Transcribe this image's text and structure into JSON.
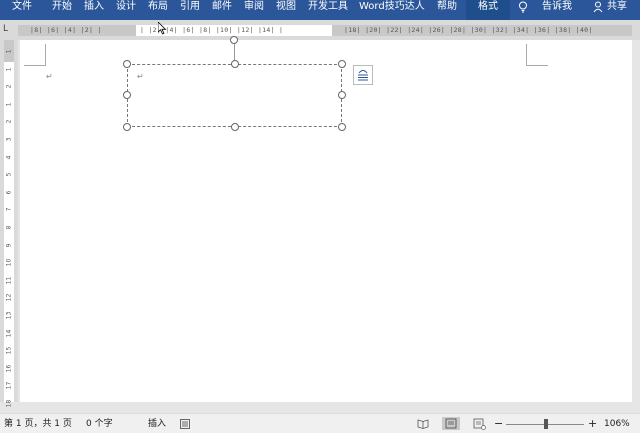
{
  "menubar": {
    "tabs": [
      "文件",
      "开始",
      "插入",
      "设计",
      "布局",
      "引用",
      "邮件",
      "审阅",
      "视图",
      "开发工具",
      "Word技巧达人",
      "帮助"
    ],
    "active_tab": "格式",
    "tell_me": "告诉我",
    "share": "共享"
  },
  "ruler": {
    "corner_glyph": "L",
    "ticks_left": "|8| |6| |4| |2| |",
    "ticks_middle": "| |2| |4| |6| |8| |10| |12| |14| |",
    "ticks_right": "|18| |20| |22| |24| |26| |28| |30| |32| |34| |36| |38| |40|",
    "vticks": [
      "1",
      "1",
      "2",
      "1",
      "2",
      "3",
      "4",
      "5",
      "6",
      "7",
      "8",
      "9",
      "10",
      "11",
      "12",
      "13",
      "14",
      "15",
      "16",
      "17",
      "18"
    ]
  },
  "document": {
    "paragraph_mark": "↵",
    "textbox_paragraph_mark": "↵"
  },
  "statusbar": {
    "page_info": "第 1 页，共 1 页",
    "word_count": "0 个字",
    "insert_mode": "插入",
    "zoom_minus": "−",
    "zoom_plus": "+",
    "zoom_level": "106%"
  },
  "colors": {
    "ribbon": "#2b579a",
    "ribbon_active": "#1e4e8c",
    "page": "#ffffff",
    "background": "#e6e6e6"
  }
}
